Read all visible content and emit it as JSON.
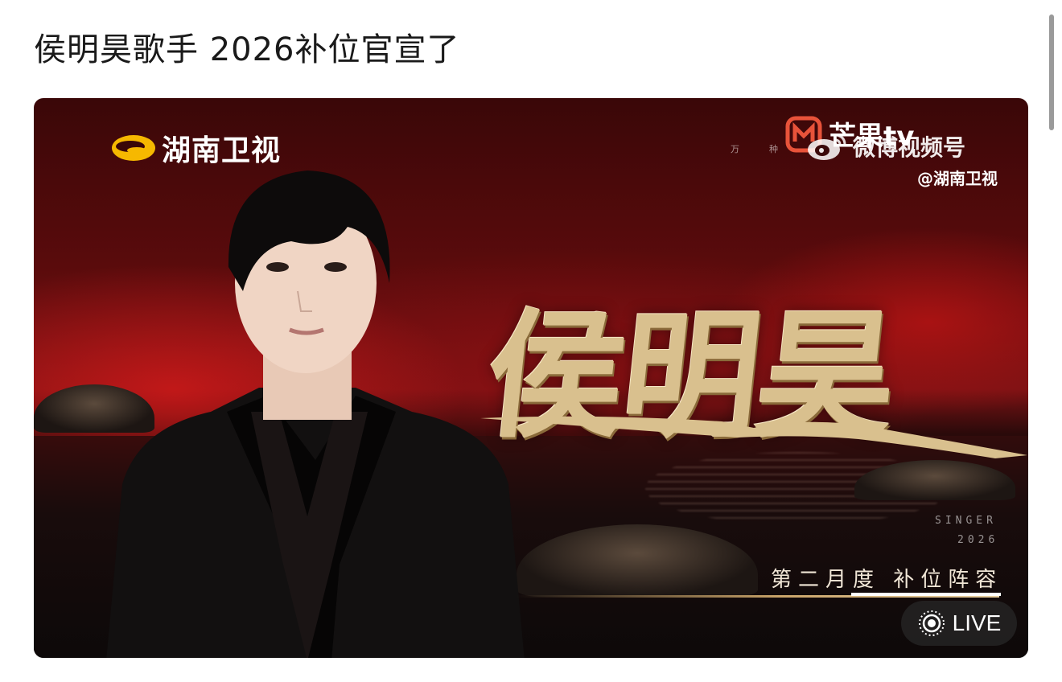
{
  "post": {
    "title": "侯明昊歌手 2026补位官宣了"
  },
  "poster": {
    "network_logo": "湖南卫视",
    "streaming_logo": "芒果tv",
    "watermark": {
      "channel": "微博视频号",
      "handle": "@湖南卫视"
    },
    "tiny_chars": [
      "万",
      "种"
    ],
    "singer_name": "侯明昊",
    "show_title": "SINGER",
    "show_year": "2026",
    "announcement": "第二月度  补位阵容",
    "colors": {
      "gold": "#d9c08e",
      "backdrop_red": "#7a1214",
      "sea_dark": "#0d0909"
    }
  },
  "live_badge": {
    "label": "LIVE",
    "icon": "live-photo-icon"
  },
  "scrollbar": {
    "position": 0
  }
}
